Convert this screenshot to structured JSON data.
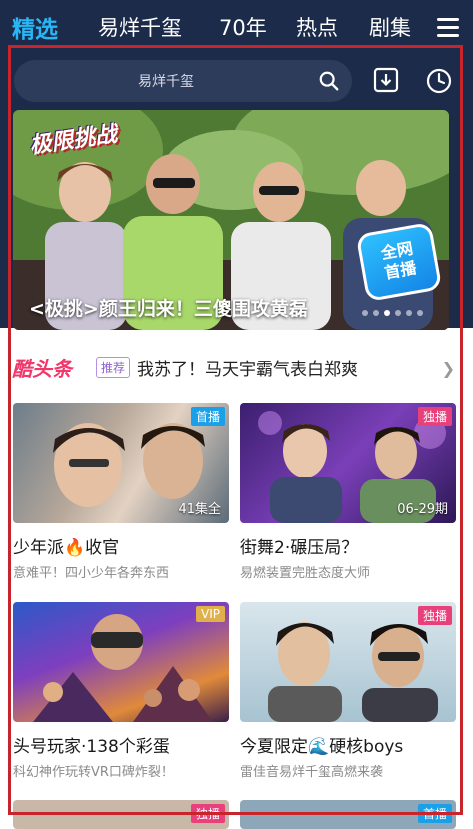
{
  "nav": {
    "tabs": [
      {
        "label": "精选",
        "active": true
      },
      {
        "label": "易烊千玺",
        "active": false
      },
      {
        "label": "70年",
        "active": false
      },
      {
        "label": "热点",
        "active": false
      },
      {
        "label": "剧集",
        "active": false
      }
    ],
    "menu_icon": "hamburger-menu-icon"
  },
  "search": {
    "placeholder": "易烊千玺",
    "icon": "search-icon"
  },
  "toolbar": {
    "download_icon": "download-icon",
    "history_icon": "history-icon"
  },
  "banner": {
    "show_logo": "极限挑战",
    "caption": "<极挑>颜王归来！三傻围攻黄磊",
    "badge_line1": "全网",
    "badge_line2": "首播",
    "slide_count": 6,
    "active_slide": 3
  },
  "headline": {
    "brand": "酷头条",
    "tag": "推荐",
    "text": "我苏了！马天宇霸气表白郑爽"
  },
  "cards": [
    {
      "title": "少年派🔥收官",
      "subtitle": "意难平！四小少年各奔东西",
      "badge": "首播",
      "badge_color": "#1aa0e8",
      "count": "41集全"
    },
    {
      "title": "街舞2·碾压局？",
      "subtitle": "易燃装置完胜态度大师",
      "badge": "独播",
      "badge_color": "#e8407a",
      "count": "06-29期"
    },
    {
      "title": "头号玩家·138个彩蛋",
      "subtitle": "科幻神作玩转VR口碑炸裂！",
      "badge": "VIP",
      "badge_color": "#e0b04a",
      "count": ""
    },
    {
      "title": "今夏限定🌊硬核boys",
      "subtitle": "雷佳音易烊千玺高燃来袭",
      "badge": "独播",
      "badge_color": "#e8407a",
      "count": ""
    }
  ],
  "peek_badges": [
    "独播",
    "首播"
  ],
  "colors": {
    "nav_bg": "#1c2b4a",
    "active_tab": "#29b6f6",
    "highlight_frame": "#c8242b",
    "brand_pink": "#f0386b"
  }
}
